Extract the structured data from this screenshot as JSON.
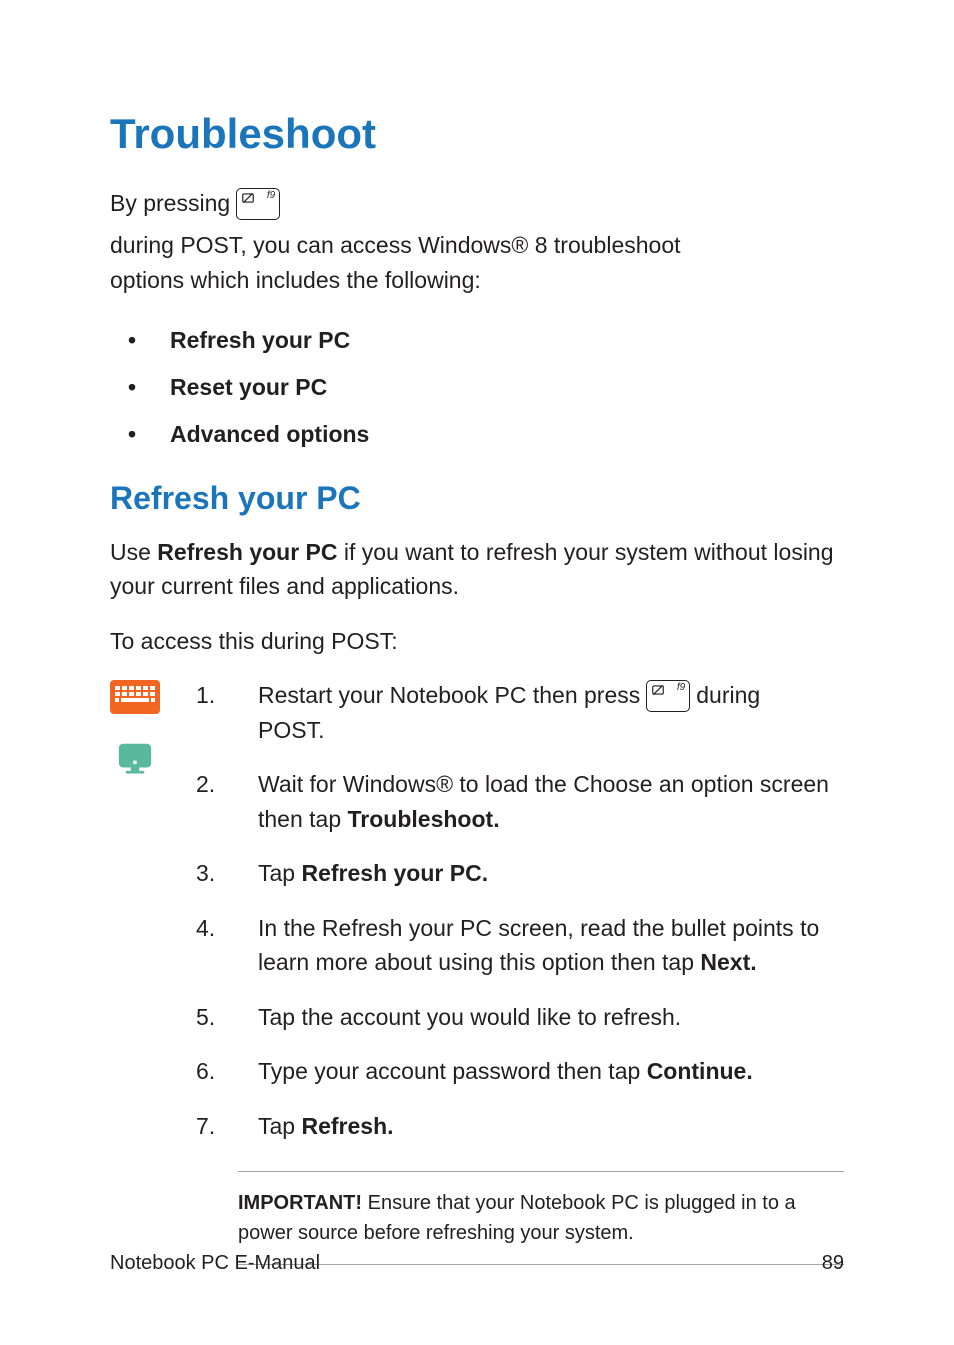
{
  "page": {
    "title": "Troubleshoot",
    "intro_before": "By pressing",
    "intro_after": "during POST, you can access Windows® 8 troubleshoot",
    "intro_line2": "options which includes the following:",
    "key_label": "f9",
    "bullets": {
      "b1": "Refresh your PC",
      "b2": "Reset your PC",
      "b3": "Advanced options"
    },
    "subhead": "Refresh your PC",
    "refresh_para_a": "Use ",
    "refresh_para_b": "Refresh your PC",
    "refresh_para_c": " if you want to refresh your system without losing your current files and applications.",
    "access_line": "To access this during POST:",
    "steps": {
      "s1_num": "1.",
      "s1_a": "Restart your Notebook PC then press",
      "s1_b": "during",
      "s1_c": "POST.",
      "s2_num": "2.",
      "s2_a": "Wait for Windows® to load the Choose an option screen then tap ",
      "s2_b": "Troubleshoot.",
      "s3_num": "3.",
      "s3_a": "Tap ",
      "s3_b": "Refresh your PC.",
      "s4_num": "4.",
      "s4_a": "In the Refresh your PC screen, read the bullet points to learn more about using this option then tap ",
      "s4_b": "Next.",
      "s5_num": "5.",
      "s5": "Tap the account you would like to refresh.",
      "s6_num": "6.",
      "s6_a": "Type your account password then tap ",
      "s6_b": "Continue.",
      "s7_num": "7.",
      "s7_a": "Tap ",
      "s7_b": "Refresh."
    },
    "note_label": "IMPORTANT!",
    "note_text": " Ensure that your Notebook PC is plugged in to a power source before refreshing your system.",
    "footer_left": "Notebook PC E-Manual",
    "footer_right": "89"
  }
}
